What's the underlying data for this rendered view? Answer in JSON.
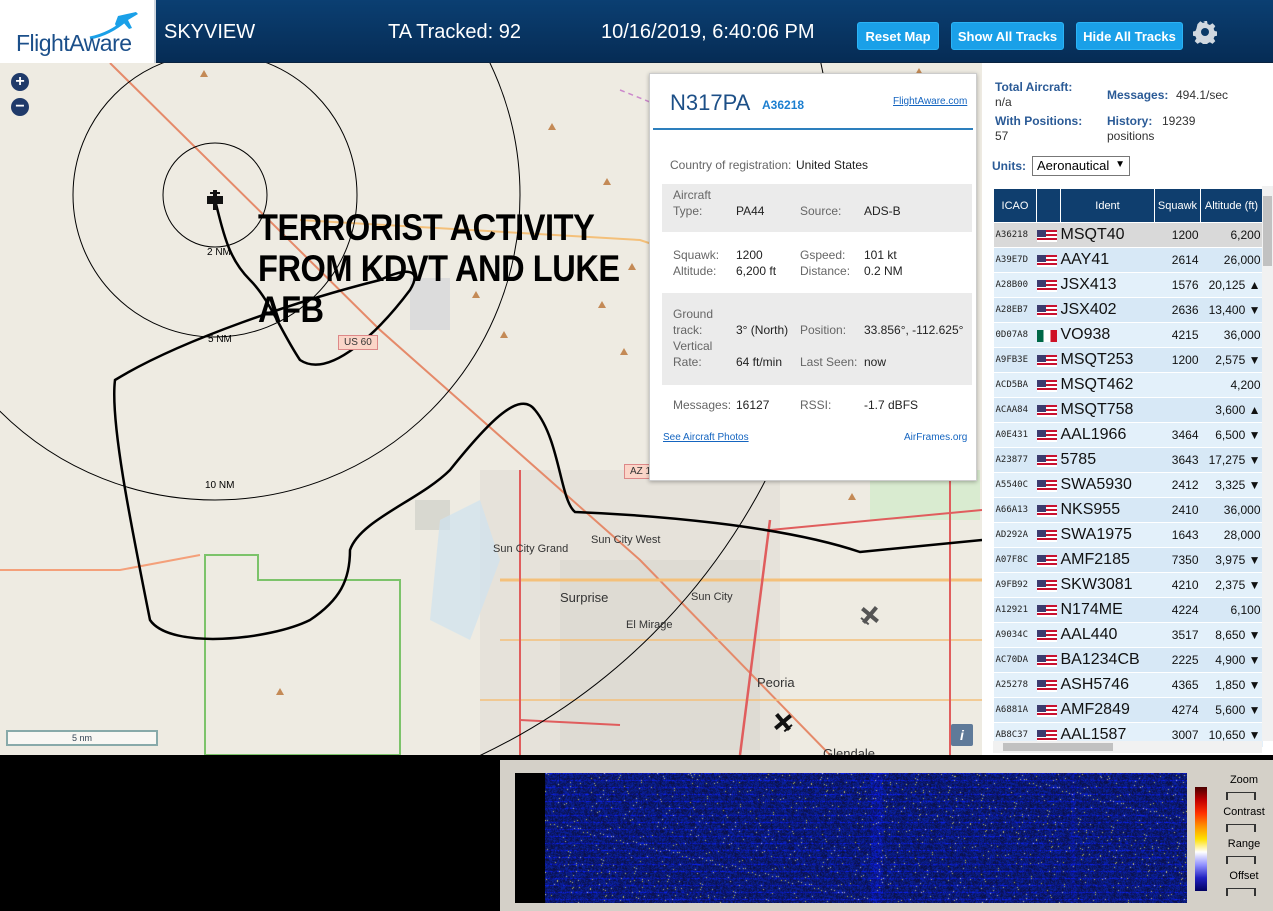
{
  "header": {
    "logo_flight": "Flight",
    "logo_aware": "Aware",
    "app_title": "SKYVIEW",
    "tracked": "TA Tracked: 92",
    "datetime": "10/16/2019, 6:40:06 PM",
    "reset_label": "Reset Map",
    "show_label": "Show All Tracks",
    "hide_label": "Hide All Tracks",
    "settings_icon": "gear-icon"
  },
  "map": {
    "overlay_text": [
      "TERRORIST ACTIVITY",
      "FROM KDVT AND LUKE",
      "AFB"
    ],
    "range_labels": [
      "2 NM",
      "5 NM",
      "10 NM"
    ],
    "places": [
      "Sun City Grand",
      "Sun City West",
      "Surprise",
      "Sun City",
      "El Mirage",
      "Peoria",
      "Glendale"
    ],
    "shields": [
      "US 60",
      "AZ 1"
    ],
    "scale": "5 nm",
    "info": "i",
    "zoom_in": "+",
    "zoom_out": "−"
  },
  "popup": {
    "ident": "N317PA",
    "icao": "A36218",
    "fa_link": "FlightAware.com",
    "country_label": "Country of registration:",
    "country": "United States",
    "aircraft_label": "Aircraft",
    "type_label": "Type:",
    "type": "PA44",
    "source_label": "Source:",
    "source": "ADS-B",
    "squawk_label": "Squawk:",
    "squawk": "1200",
    "gspeed_label": "Gspeed:",
    "gspeed": "101 kt",
    "altitude_label": "Altitude:",
    "altitude": "6,200 ft",
    "distance_label": "Distance:",
    "distance": "0.2 NM",
    "ground_label": "Ground",
    "track_label": "track:",
    "track": "3° (North)",
    "position_label": "Position:",
    "position": "33.856°, -112.625°",
    "vertical_label": "Vertical",
    "rate_label": "Rate:",
    "rate": "64 ft/min",
    "lastseen_label": "Last Seen:",
    "lastseen": "now",
    "messages_label": "Messages:",
    "messages": "16127",
    "rssi_label": "RSSI:",
    "rssi": "-1.7 dBFS",
    "photos_link": "See Aircraft Photos",
    "airframes_link": "AirFrames.org"
  },
  "panel": {
    "total_label": "Total Aircraft:",
    "total": "n/a",
    "messages_label": "Messages:",
    "messages": "494.1/sec",
    "withpos_label": "With Positions:",
    "withpos": "57",
    "history_label": "History:",
    "history": "19239",
    "history_unit": "positions",
    "units_label": "Units:",
    "units_value": "Aeronautical",
    "columns": [
      "ICAO",
      "",
      "Ident",
      "Squawk",
      "Altitude (ft)"
    ],
    "rows": [
      {
        "icao": "A36218",
        "flag": "us",
        "ident": "MSQT40",
        "squawk": "1200",
        "alt": "6,200"
      },
      {
        "icao": "A39E7D",
        "flag": "us",
        "ident": "AAY41",
        "squawk": "2614",
        "alt": "26,000"
      },
      {
        "icao": "A28B00",
        "flag": "us",
        "ident": "JSX413",
        "squawk": "1576",
        "alt": "20,125 ▲"
      },
      {
        "icao": "A28EB7",
        "flag": "us",
        "ident": "JSX402",
        "squawk": "2636",
        "alt": "13,400 ▼"
      },
      {
        "icao": "0D07A8",
        "flag": "mx",
        "ident": "VO938",
        "squawk": "4215",
        "alt": "36,000"
      },
      {
        "icao": "A9FB3E",
        "flag": "us",
        "ident": "MSQT253",
        "squawk": "1200",
        "alt": "2,575 ▼"
      },
      {
        "icao": "ACD5BA",
        "flag": "us",
        "ident": "MSQT462",
        "squawk": "",
        "alt": "4,200"
      },
      {
        "icao": "ACAA84",
        "flag": "us",
        "ident": "MSQT758",
        "squawk": "",
        "alt": "3,600 ▲"
      },
      {
        "icao": "A0E431",
        "flag": "us",
        "ident": "AAL1966",
        "squawk": "3464",
        "alt": "6,500 ▼"
      },
      {
        "icao": "A23877",
        "flag": "us",
        "ident": "5785",
        "squawk": "3643",
        "alt": "17,275 ▼"
      },
      {
        "icao": "A5540C",
        "flag": "us",
        "ident": "SWA5930",
        "squawk": "2412",
        "alt": "3,325 ▼"
      },
      {
        "icao": "A66A13",
        "flag": "us",
        "ident": "NKS955",
        "squawk": "2410",
        "alt": "36,000"
      },
      {
        "icao": "AD292A",
        "flag": "us",
        "ident": "SWA1975",
        "squawk": "1643",
        "alt": "28,000"
      },
      {
        "icao": "A07F8C",
        "flag": "us",
        "ident": "AMF2185",
        "squawk": "7350",
        "alt": "3,975 ▼"
      },
      {
        "icao": "A9FB92",
        "flag": "us",
        "ident": "SKW3081",
        "squawk": "4210",
        "alt": "2,375 ▼"
      },
      {
        "icao": "A12921",
        "flag": "us",
        "ident": "N174ME",
        "squawk": "4224",
        "alt": "6,100"
      },
      {
        "icao": "A9034C",
        "flag": "us",
        "ident": "AAL440",
        "squawk": "3517",
        "alt": "8,650 ▼"
      },
      {
        "icao": "AC70DA",
        "flag": "us",
        "ident": "BA1234CB",
        "squawk": "2225",
        "alt": "4,900 ▼"
      },
      {
        "icao": "A25278",
        "flag": "us",
        "ident": "ASH5746",
        "squawk": "4365",
        "alt": "1,850 ▼"
      },
      {
        "icao": "A6881A",
        "flag": "us",
        "ident": "AMF2849",
        "squawk": "4274",
        "alt": "5,600 ▼"
      },
      {
        "icao": "AB8C37",
        "flag": "us",
        "ident": "AAL1587",
        "squawk": "3007",
        "alt": "10,650 ▼"
      }
    ]
  },
  "spectrum": {
    "zoom": "Zoom",
    "contrast": "Contrast",
    "range": "Range",
    "offset": "Offset"
  }
}
